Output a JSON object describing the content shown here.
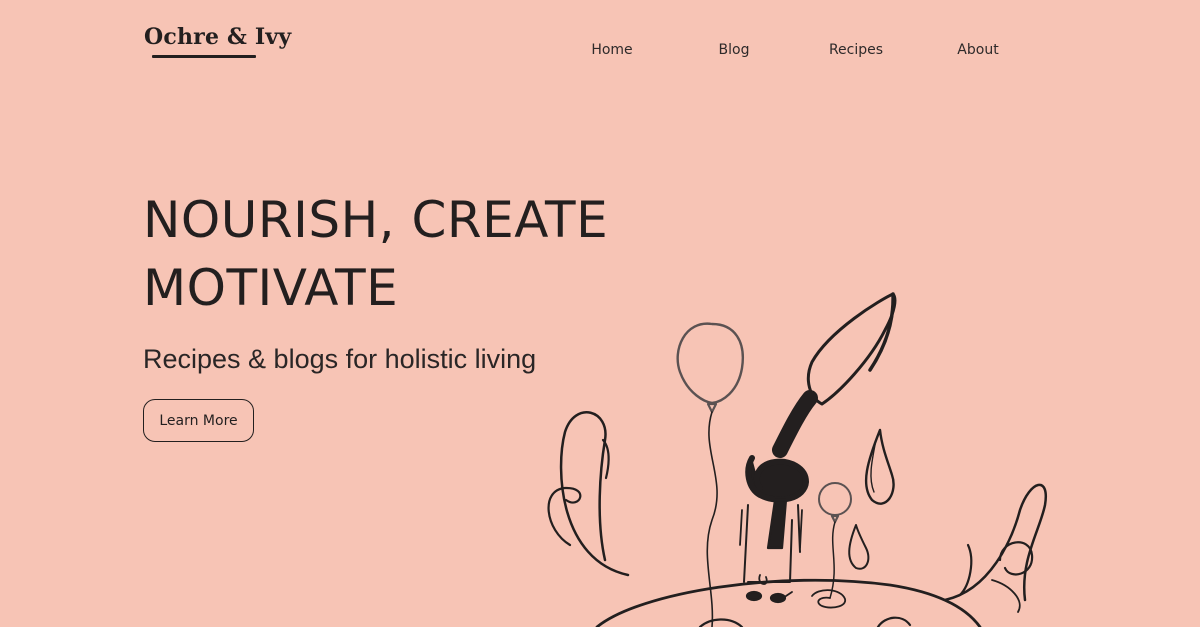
{
  "brand": {
    "name": "Ochre & Ivy"
  },
  "nav": {
    "items": [
      {
        "label": "Home"
      },
      {
        "label": "Blog"
      },
      {
        "label": "Recipes"
      },
      {
        "label": "About"
      }
    ]
  },
  "hero": {
    "title_line1": "NOURISH, CREATE",
    "title_line2": "MOTIVATE",
    "subtitle": "Recipes & blogs for holistic living",
    "cta_label": "Learn More"
  },
  "colors": {
    "background": "#f7c4b5",
    "text": "#231f1f"
  },
  "illustration": {
    "icon": "paintbrush-balloons-illustration"
  }
}
